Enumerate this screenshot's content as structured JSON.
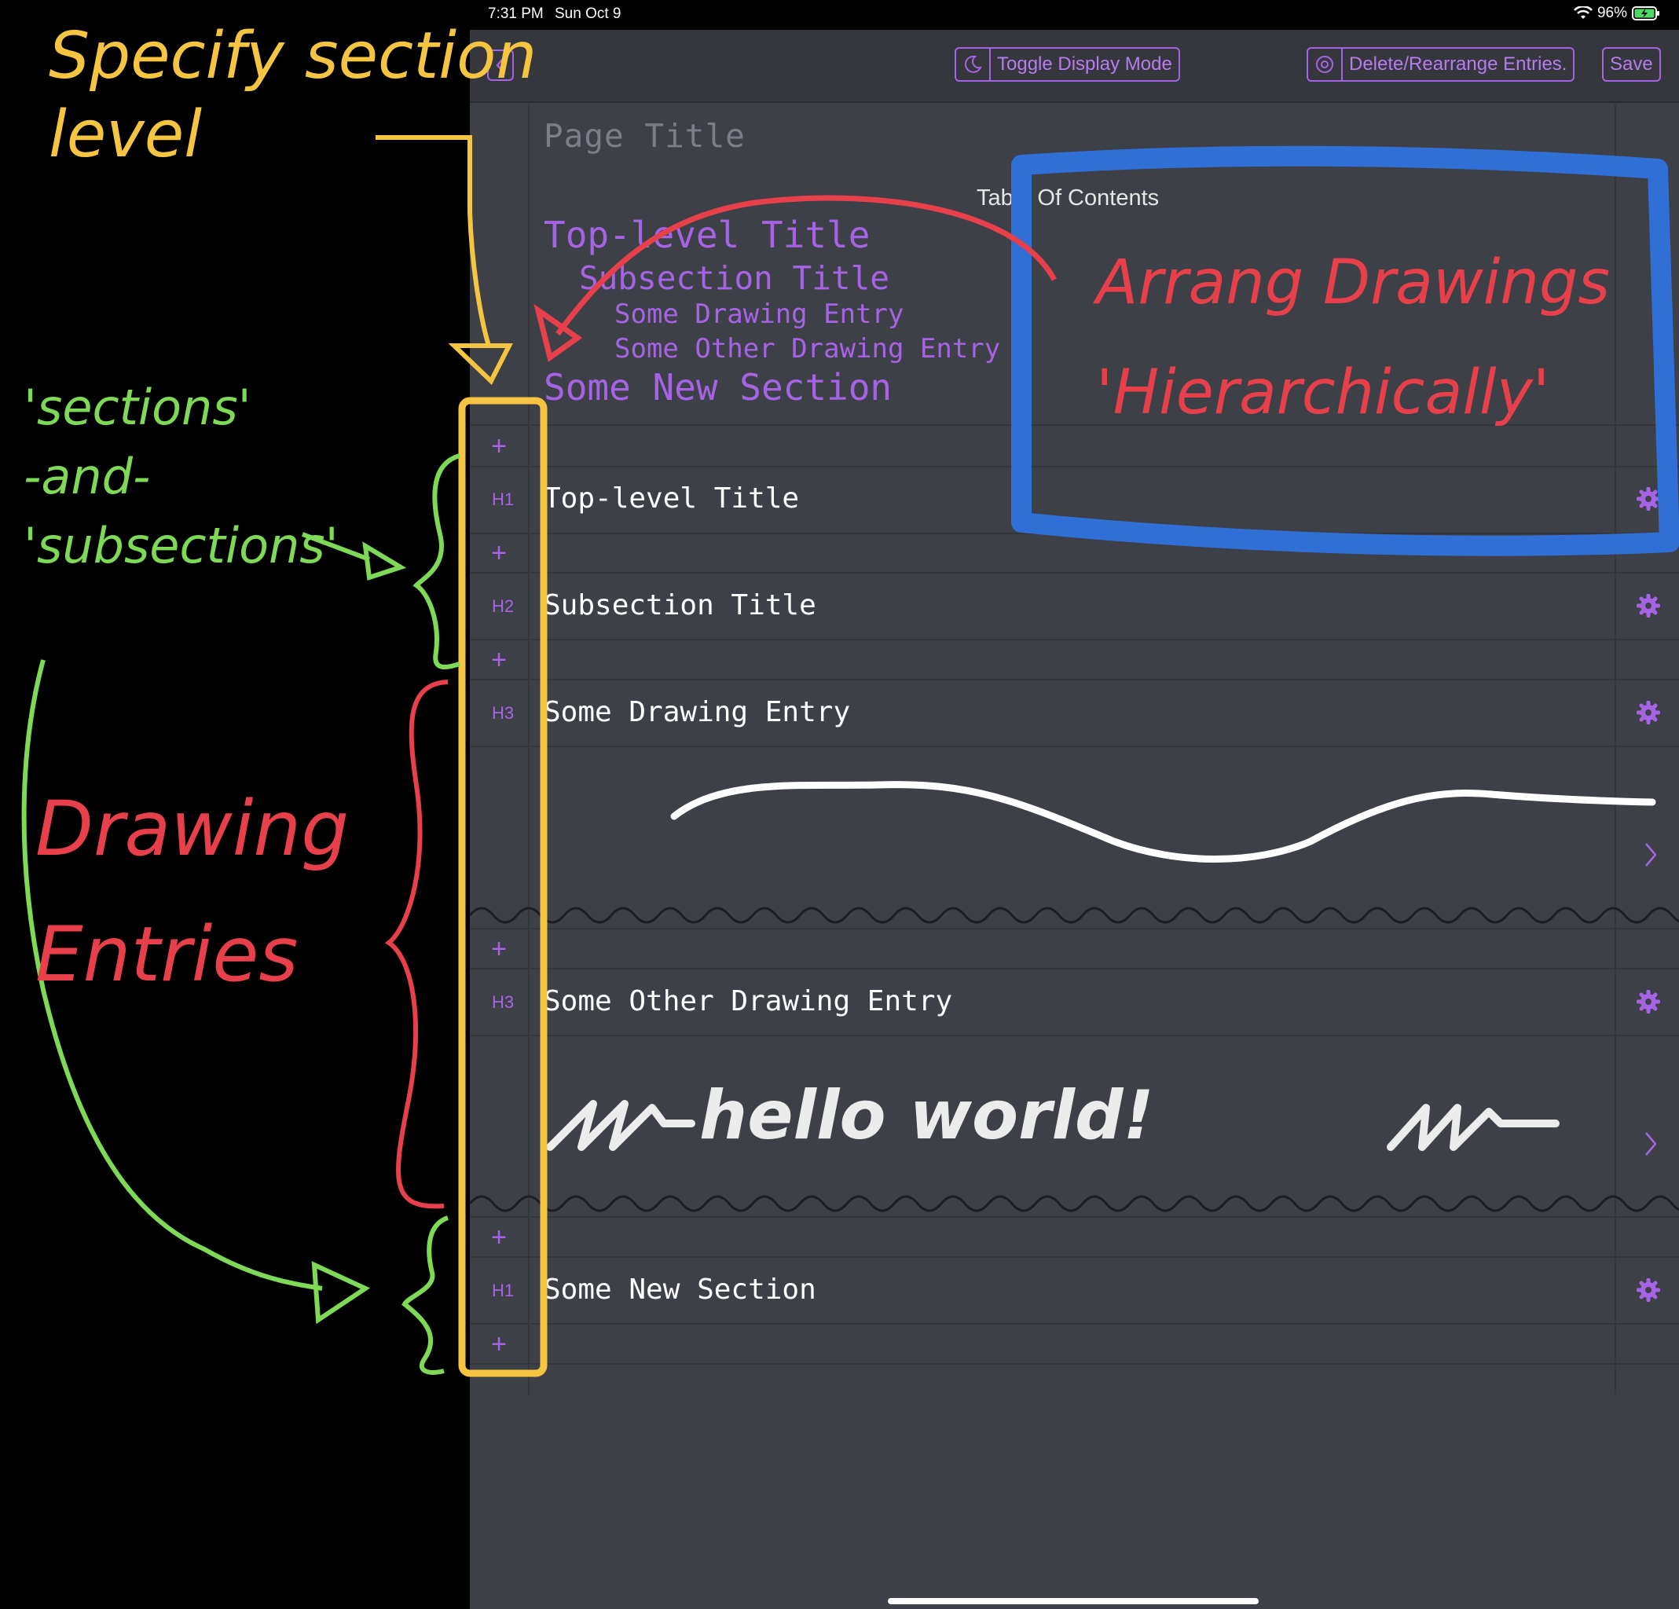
{
  "status_bar": {
    "time": "7:31 PM",
    "date": "Sun Oct 9",
    "battery": "96%"
  },
  "toolbar": {
    "toggle_label": "Toggle Display Mode",
    "delete_label": "Delete/Rearrange Entries.",
    "save_label": "Save"
  },
  "page": {
    "title_placeholder": "Page Title",
    "toc_heading": "Table Of Contents",
    "toc": [
      {
        "text": "Top-level Title",
        "level": 1
      },
      {
        "text": "Subsection Title",
        "level": 2
      },
      {
        "text": "Some Drawing Entry",
        "level": 3
      },
      {
        "text": "Some Other Drawing Entry",
        "level": 3
      },
      {
        "text": "Some New Section",
        "level": 1
      }
    ]
  },
  "entries": [
    {
      "level": "H1",
      "title": "Top-level Title",
      "has_drawing": false
    },
    {
      "level": "H2",
      "title": "Subsection Title",
      "has_drawing": false
    },
    {
      "level": "H3",
      "title": "Some Drawing Entry",
      "has_drawing": true
    },
    {
      "level": "H3",
      "title": "Some Other Drawing Entry",
      "has_drawing": true,
      "drawing_text": "hello world!"
    },
    {
      "level": "H1",
      "title": "Some New Section",
      "has_drawing": false
    }
  ],
  "annotations": {
    "specify_section_level": "Specify section\nlevel",
    "sections_and_subsections": "'sections'\n-and-\n'subsections'",
    "drawing_entries": "Drawing\nEntries",
    "arrange_drawings": "Arrang Drawings\n'Hierarchically'"
  },
  "colors": {
    "accent": "#a763e6",
    "background": "#3e4047",
    "toolbar": "#35373d",
    "annotation_yellow": "#f5c542",
    "annotation_green": "#7ed957",
    "annotation_red": "#e8404a",
    "annotation_blue": "#2f6fd6"
  }
}
